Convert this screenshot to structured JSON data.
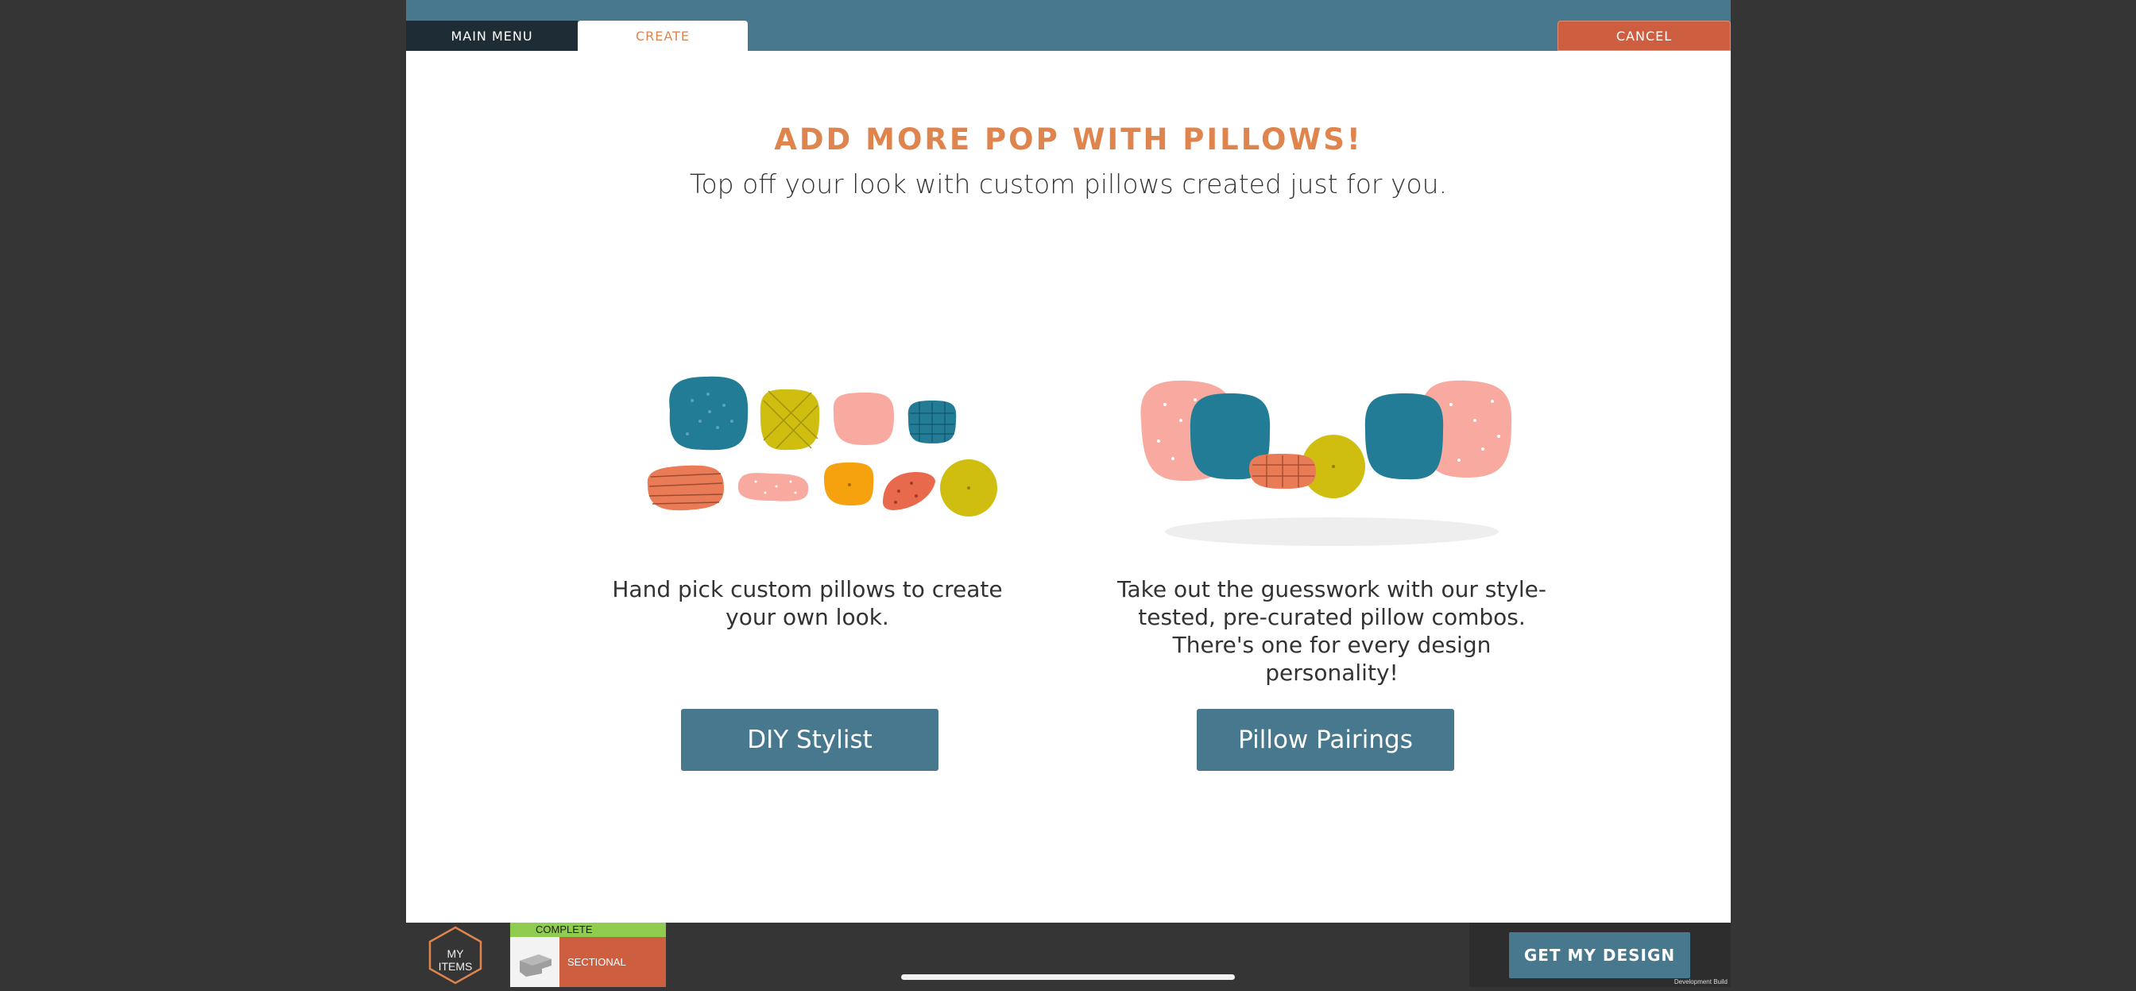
{
  "tabs": {
    "main_menu": "MAIN MENU",
    "create": "CREATE",
    "cancel": "CANCEL"
  },
  "hero": {
    "title": "ADD MORE POP WITH PILLOWS!",
    "subtitle": "Top off your look with custom pillows created just for you."
  },
  "options": [
    {
      "description": "Hand pick custom pillows to create your own look.",
      "button_label": "DIY Stylist",
      "illustration": "assorted-pillows-icon"
    },
    {
      "description": "Take out the guesswork with our style-tested, pre-curated pillow combos. There's one for every design personality!",
      "button_label": "Pillow Pairings",
      "illustration": "pillow-pairing-icon"
    }
  ],
  "bottom_bar": {
    "my_items_line1": "MY",
    "my_items_line2": "ITEMS",
    "item_status": "COMPLETE",
    "item_name": "SECTIONAL",
    "get_design": "GET MY DESIGN",
    "dev_build": "Development Build"
  },
  "colors": {
    "header_teal": "#48788d",
    "accent_orange": "#e0844e",
    "cancel_red": "#cd5f40",
    "status_green": "#8fcc50"
  }
}
